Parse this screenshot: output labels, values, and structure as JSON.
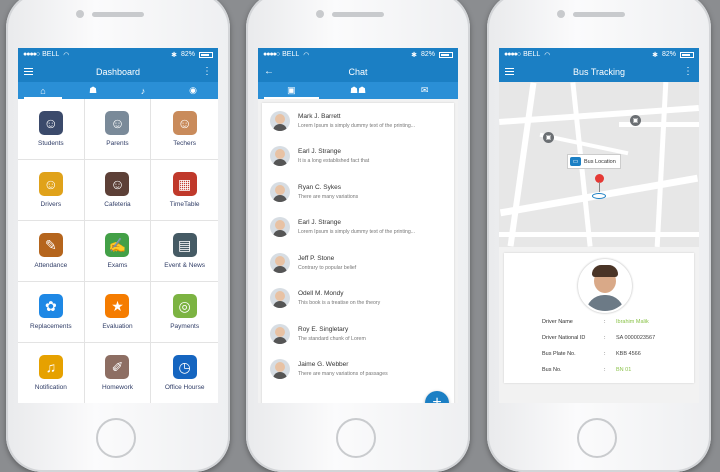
{
  "status_bar": {
    "carrier": "BELL",
    "battery": "82%"
  },
  "dashboard": {
    "title": "Dashboard",
    "tabs": [
      "home",
      "user",
      "bell",
      "profile"
    ],
    "items": [
      {
        "label": "Students",
        "icon": "student-icon",
        "color": "#3b4a6b"
      },
      {
        "label": "Parents",
        "icon": "parents-icon",
        "color": "#7a8a99"
      },
      {
        "label": "Techers",
        "icon": "teacher-icon",
        "color": "#c98b5b"
      },
      {
        "label": "Drivers",
        "icon": "driver-icon",
        "color": "#e0a21a"
      },
      {
        "label": "Cafeteria",
        "icon": "chef-icon",
        "color": "#5d4037"
      },
      {
        "label": "TimeTable",
        "icon": "calendar-icon",
        "color": "#c0392b"
      },
      {
        "label": "Attendance",
        "icon": "clipboard-icon",
        "color": "#b5651d"
      },
      {
        "label": "Exams",
        "icon": "exam-icon",
        "color": "#43a047"
      },
      {
        "label": "Event & News",
        "icon": "newspaper-icon",
        "color": "#455a64"
      },
      {
        "label": "Replacements",
        "icon": "group-icon",
        "color": "#1e88e5"
      },
      {
        "label": "Evaluation",
        "icon": "stars-icon",
        "color": "#f57c00"
      },
      {
        "label": "Payments",
        "icon": "coins-icon",
        "color": "#7cb342"
      },
      {
        "label": "Notification",
        "icon": "bell-icon",
        "color": "#e6a100"
      },
      {
        "label": "Homework",
        "icon": "homework-icon",
        "color": "#8d6e63"
      },
      {
        "label": "Office Hourse",
        "icon": "clock-icon",
        "color": "#1565c0"
      }
    ]
  },
  "chat": {
    "title": "Chat",
    "messages": [
      {
        "name": "Mark J. Barrett",
        "text": "Lorem Ipsum is simply dummy text of the printing..."
      },
      {
        "name": "Earl J. Strange",
        "text": "It is a long established fact that"
      },
      {
        "name": "Ryan C. Sykes",
        "text": "There are many variations"
      },
      {
        "name": "Earl J. Strange",
        "text": "Lorem Ipsum is simply dummy text of the printing..."
      },
      {
        "name": "Jeff P. Stone",
        "text": "Contrary to popular belief"
      },
      {
        "name": "Odell M. Mondy",
        "text": "This book is a treatise on the theory"
      },
      {
        "name": "Roy E. Singletary",
        "text": "The standard chunk of Lorem"
      },
      {
        "name": "Jaime G. Webber",
        "text": "There are many variations of passages"
      }
    ],
    "fab": "+"
  },
  "bus": {
    "title": "Bus Tracking",
    "location_label": "Bus Location",
    "info": [
      {
        "key": "Driver Name",
        "value": "Ibrahim Malik",
        "highlight": true
      },
      {
        "key": "Driver National ID",
        "value": "SA 0000023567",
        "highlight": false
      },
      {
        "key": "Bus Plate No.",
        "value": "KBB 4566",
        "highlight": false
      },
      {
        "key": "Bus No.",
        "value": "BN 01",
        "highlight": true
      }
    ],
    "separator": ":"
  },
  "colors": {
    "primary": "#1b7fc4",
    "tab_bar": "#2a8fd6",
    "highlight": "#8bc34a"
  }
}
